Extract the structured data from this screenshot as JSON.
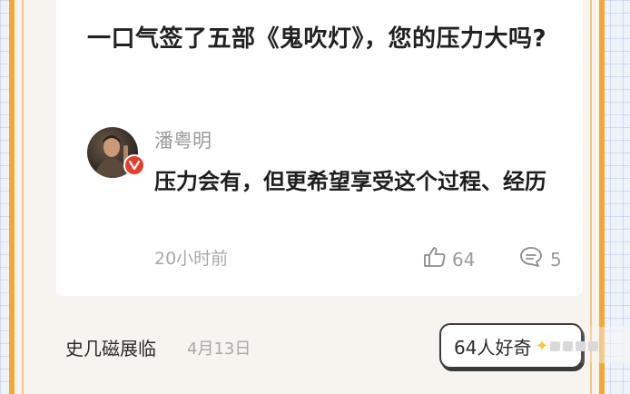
{
  "question": "一口气签了五部《鬼吹灯》，您的压力大吗?",
  "answer": {
    "author": "潘粤明",
    "text": "压力会有，但更希望享受这个过程、经历",
    "time": "20小时前",
    "likes": "64",
    "comments": "5"
  },
  "footer": {
    "user": "史几磁展临",
    "date": "4月13日",
    "curious_label": "64人好奇"
  },
  "icons": {
    "like": "thumbs-up-icon",
    "comment": "comment-bubble-icon",
    "verified": "verified-v-badge-icon",
    "sparkle": "sparkle-icon"
  },
  "colors": {
    "frame_orange": "#f3a833",
    "verified_red": "#e63e2e",
    "sparkle_yellow": "#f6c94a"
  }
}
